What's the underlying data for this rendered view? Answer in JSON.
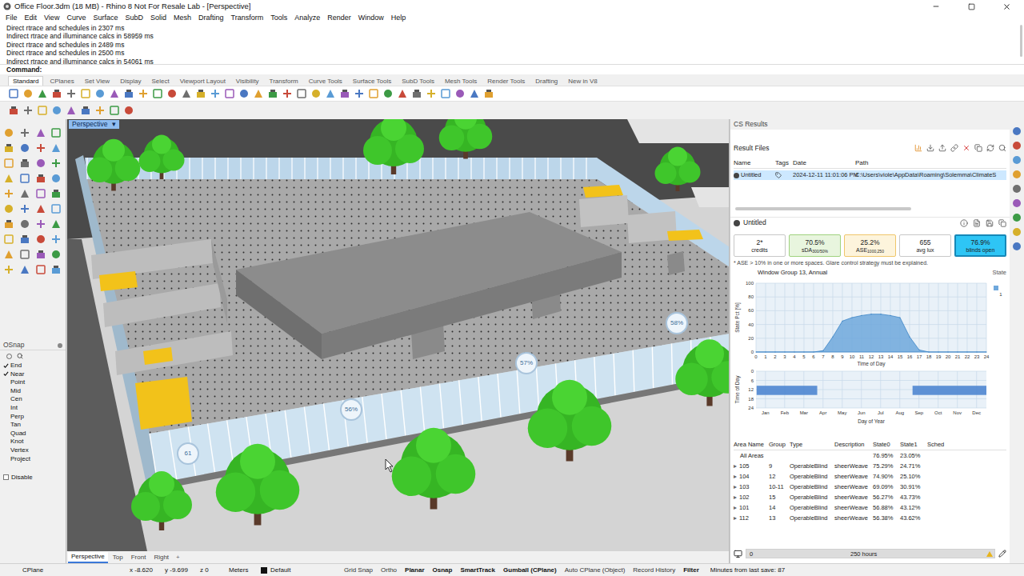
{
  "window": {
    "title": "Office Floor.3dm (18 MB) - Rhino 8 Not For Resale Lab - [Perspective]"
  },
  "menu": [
    "File",
    "Edit",
    "View",
    "Curve",
    "Surface",
    "SubD",
    "Solid",
    "Mesh",
    "Drafting",
    "Transform",
    "Tools",
    "Analyze",
    "Render",
    "Window",
    "Help"
  ],
  "command_history": [
    "Direct rtrace and schedules in 2307 ms",
    "Indirect rtrace and illuminance calcs in 58959 ms",
    "Direct rtrace and schedules in 2489 ms",
    "Direct rtrace and schedules in 2500 ms",
    "Indirect rtrace and illuminance calcs in 54061 ms"
  ],
  "command_prompt": "Command:",
  "toolbar_tabs": [
    {
      "label": "Standard",
      "selected": true
    },
    {
      "label": "CPlanes",
      "selected": false
    },
    {
      "label": "Set View",
      "selected": false
    },
    {
      "label": "Display",
      "selected": false
    },
    {
      "label": "Select",
      "selected": false
    },
    {
      "label": "Viewport Layout",
      "selected": false
    },
    {
      "label": "Visibility",
      "selected": false
    },
    {
      "label": "Transform",
      "selected": false
    },
    {
      "label": "Curve Tools",
      "selected": false
    },
    {
      "label": "Surface Tools",
      "selected": false
    },
    {
      "label": "SubD Tools",
      "selected": false
    },
    {
      "label": "Mesh Tools",
      "selected": false
    },
    {
      "label": "Render Tools",
      "selected": false
    },
    {
      "label": "Drafting",
      "selected": false
    },
    {
      "label": "New in V8",
      "selected": false
    }
  ],
  "viewport": {
    "label": "Perspective",
    "label_menu": "▾",
    "badges": [
      "58%",
      "57%",
      "56%",
      "61"
    ],
    "tabs": [
      {
        "label": "Perspective",
        "selected": true
      },
      {
        "label": "Top",
        "selected": false
      },
      {
        "label": "Front",
        "selected": false
      },
      {
        "label": "Right",
        "selected": false
      }
    ],
    "add_tab": "+"
  },
  "osnap": {
    "title": "OSnap",
    "items": [
      {
        "label": "End",
        "checked": true
      },
      {
        "label": "Near",
        "checked": true
      },
      {
        "label": "Point",
        "checked": false
      },
      {
        "label": "Mid",
        "checked": false
      },
      {
        "label": "Cen",
        "checked": false
      },
      {
        "label": "Int",
        "checked": false
      },
      {
        "label": "Perp",
        "checked": false
      },
      {
        "label": "Tan",
        "checked": false
      },
      {
        "label": "Quad",
        "checked": false
      },
      {
        "label": "Knot",
        "checked": false
      },
      {
        "label": "Vertex",
        "checked": false
      },
      {
        "label": "Project",
        "checked": false
      }
    ],
    "disable": {
      "label": "Disable",
      "checked": false
    }
  },
  "cs_results": {
    "title": "CS Results",
    "result_files": {
      "title": "Result Files",
      "columns": [
        "Name",
        "Tags",
        "Date",
        "Path"
      ],
      "rows": [
        {
          "name": "Untitled",
          "date": "2024-12-11 11:01:06 PM",
          "path": "C:\\Users\\viole\\AppData\\Roaming\\Solemma\\ClimateS",
          "selected": true
        }
      ]
    },
    "result": {
      "title": "Untitled",
      "metrics": [
        {
          "value": "2*",
          "label": "credits",
          "sub": "",
          "color": "#ffffff",
          "border_color": "#c8c8c8",
          "selected": false
        },
        {
          "value": "70.5%",
          "label": "sDA",
          "sub": "300/50%",
          "color": "#e8f5de",
          "border_color": "#9fd27f",
          "selected": false
        },
        {
          "value": "25.2%",
          "label": "ASE",
          "sub": "1000,250",
          "color": "#fdf4dc",
          "border_color": "#efc66a",
          "selected": false
        },
        {
          "value": "655",
          "label": "avg lux",
          "sub": "",
          "color": "#ffffff",
          "border_color": "#c8c8c8",
          "selected": false
        },
        {
          "value": "76.9%",
          "label": "blinds open",
          "sub": "",
          "color": "#2ec5f5",
          "border_color": "#1688b8",
          "selected": true
        }
      ],
      "note": "* ASE > 10% in one or more spaces. Glare control strategy must be explained.",
      "chart_title": "Window Group 13, Annual",
      "state_label": "State",
      "daily_chart": {
        "y_label": "State Pct [%]",
        "x_label": "Time of Day",
        "y_ticks": [
          "0",
          "20",
          "40",
          "60",
          "80",
          "100"
        ],
        "x_ticks": [
          "0",
          "1",
          "2",
          "3",
          "4",
          "5",
          "6",
          "7",
          "8",
          "9",
          "10",
          "11",
          "12",
          "13",
          "14",
          "15",
          "16",
          "17",
          "18",
          "19",
          "20",
          "21",
          "22",
          "23",
          "24"
        ],
        "legend": "1",
        "series": [
          {
            "name": "1",
            "color": "#6fa8dc",
            "values": [
              0,
              0,
              0,
              0,
              0,
              0,
              0,
              2,
              22,
              45,
              50,
              53,
              55,
              55,
              53,
              50,
              22,
              3,
              0,
              0,
              0,
              0,
              0,
              0,
              0
            ]
          }
        ]
      },
      "annual_chart": {
        "y_label": "Time of Day",
        "x_label": "Day of Year",
        "y_ticks": [
          "0",
          "6",
          "12",
          "18",
          "24"
        ],
        "x_ticks": [
          "Jan",
          "Feb",
          "Mar",
          "Apr",
          "May",
          "Jun",
          "Jul",
          "Aug",
          "Sep",
          "Oct",
          "Nov",
          "Dec"
        ],
        "color": "#4f86d0",
        "bands": [
          {
            "from_day": 1,
            "to_day": 97,
            "from_hour": 9.5,
            "to_hour": 15.5
          },
          {
            "from_day": 248,
            "to_day": 365,
            "from_hour": 9.5,
            "to_hour": 15.5
          }
        ]
      },
      "table": {
        "columns": [
          "Area Name",
          "Group",
          "Type",
          "Description",
          "State0",
          "State1",
          "Sched"
        ],
        "rows": [
          {
            "expander": "",
            "area": "All Areas",
            "group": "",
            "type": "",
            "description": "",
            "state0": "76.95%",
            "state1": "23.05%"
          },
          {
            "expander": "▸",
            "area": "105",
            "group": "9",
            "type": "OperableBlind",
            "description": "sheerWeave",
            "state0": "75.29%",
            "state1": "24.71%"
          },
          {
            "expander": "▸",
            "area": "104",
            "group": "12",
            "type": "OperableBlind",
            "description": "sheerWeave",
            "state0": "74.90%",
            "state1": "25.10%"
          },
          {
            "expander": "▸",
            "area": "103",
            "group": "10-11",
            "type": "OperableBlind",
            "description": "sheerWeave",
            "state0": "69.09%",
            "state1": "30.91%"
          },
          {
            "expander": "▸",
            "area": "102",
            "group": "15",
            "type": "OperableBlind",
            "description": "sheerWeave",
            "state0": "56.27%",
            "state1": "43.73%"
          },
          {
            "expander": "▸",
            "area": "101",
            "group": "14",
            "type": "OperableBlind",
            "description": "sheerWeave",
            "state0": "56.88%",
            "state1": "43.12%"
          },
          {
            "expander": "▸",
            "area": "112",
            "group": "13",
            "type": "OperableBlind",
            "description": "sheerWeave",
            "state0": "56.38%",
            "state1": "43.62%"
          }
        ]
      },
      "slider": {
        "min_label": "0",
        "value_label": "250 hours",
        "level": 1
      }
    }
  },
  "status_bar": {
    "cplane": "CPlane",
    "x": "x -8.620",
    "y": "y -9.699",
    "z": "z 0",
    "units": "Meters",
    "layer": {
      "label": "Default",
      "color": "#111111"
    },
    "toggles": [
      {
        "label": "Grid Snap",
        "on": false
      },
      {
        "label": "Ortho",
        "on": false
      },
      {
        "label": "Planar",
        "on": true
      },
      {
        "label": "Osnap",
        "on": true
      },
      {
        "label": "SmartTrack",
        "on": true
      },
      {
        "label": "Gumball (CPlane)",
        "on": true
      },
      {
        "label": "Auto CPlane (Object)",
        "on": false
      },
      {
        "label": "Record History",
        "on": false
      },
      {
        "label": "Filter",
        "on": true
      }
    ],
    "save_info": "Minutes from last save: 87"
  }
}
